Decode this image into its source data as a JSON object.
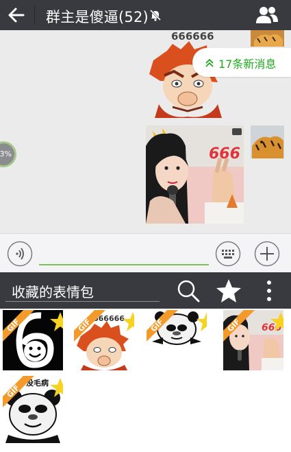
{
  "header": {
    "title": "群主是傻逼(52)",
    "back_icon": "arrow-left-icon",
    "mute_icon": "bell-muted-icon",
    "members_icon": "people-icon"
  },
  "chat": {
    "new_messages": "17条新消息",
    "sticker_caption_top": "666666",
    "photo_caption": "666",
    "upload_progress": "3%"
  },
  "input_bar": {
    "voice_icon": "voice-icon",
    "keyboard_icon": "keyboard-icon",
    "plus_icon": "plus-icon",
    "accent_color": "#7dc353"
  },
  "sticker_panel": {
    "title": "收藏的表情包",
    "search_icon": "search-icon",
    "star_icon": "star-icon",
    "more_icon": "more-vertical-icon",
    "items": [
      {
        "badge": "GIF",
        "caption": ""
      },
      {
        "badge": "GIF",
        "caption": "666666"
      },
      {
        "badge": "GIF",
        "caption": ""
      },
      {
        "badge": "GIF",
        "caption": "666"
      },
      {
        "badge": "GIF",
        "caption": "没毛病"
      }
    ]
  },
  "colors": {
    "topbar": "#393a3f",
    "chat_background": "#ebebeb",
    "accent_green": "#1aad19",
    "badge_orange": "#f39a2b",
    "star_yellow": "#f7d21e"
  }
}
